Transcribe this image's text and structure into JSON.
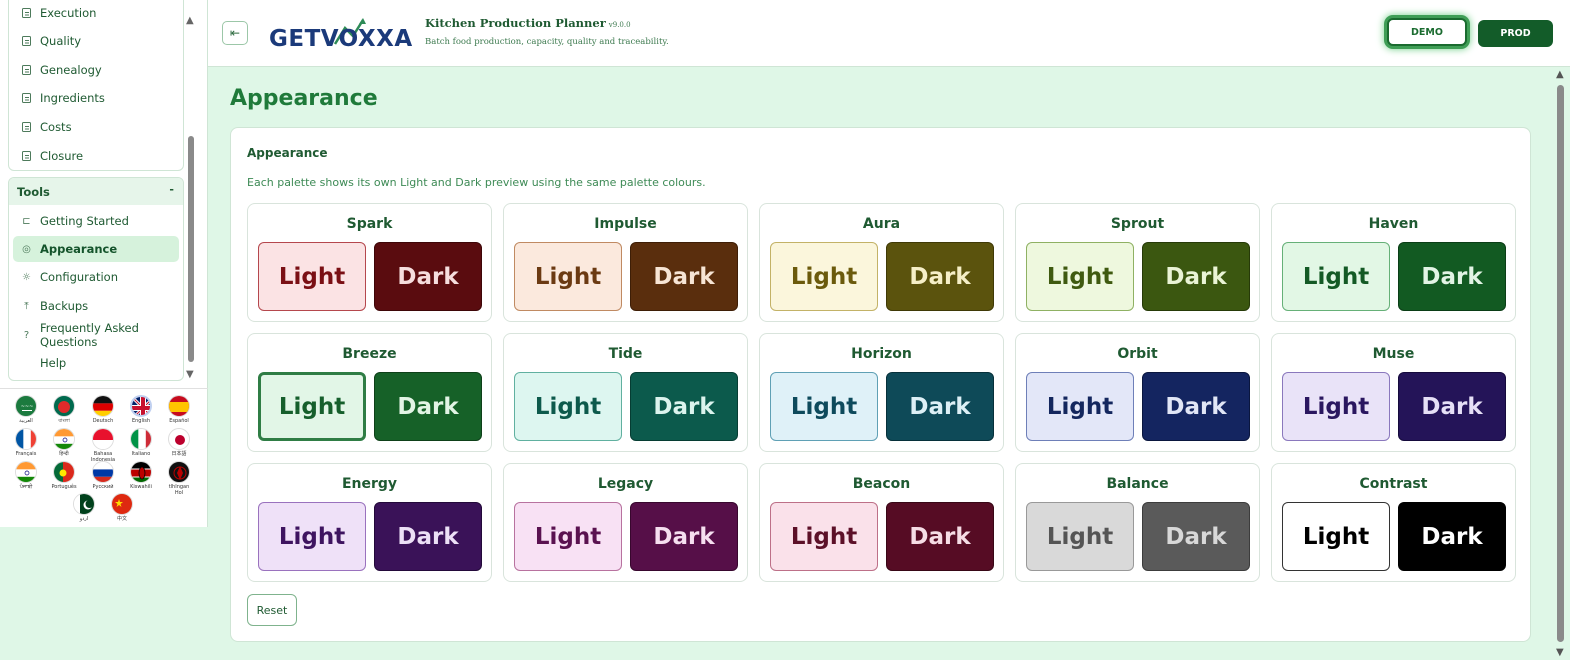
{
  "sidebar": {
    "top_items": [
      {
        "label": "Execution",
        "icon": "document-icon"
      },
      {
        "label": "Quality",
        "icon": "document-icon"
      },
      {
        "label": "Genealogy",
        "icon": "document-icon"
      },
      {
        "label": "Ingredients",
        "icon": "document-icon"
      },
      {
        "label": "Costs",
        "icon": "document-icon"
      },
      {
        "label": "Closure",
        "icon": "document-icon"
      }
    ],
    "tools": {
      "header": "Tools",
      "collapse_symbol": "-",
      "items": [
        {
          "label": "Getting Started",
          "icon": "flag-icon",
          "glyph": "⊏"
        },
        {
          "label": "Appearance",
          "icon": "palette-icon",
          "glyph": "◎",
          "active": true
        },
        {
          "label": "Configuration",
          "icon": "sun-icon",
          "glyph": "☼"
        },
        {
          "label": "Backups",
          "icon": "upload-icon",
          "glyph": "⤒"
        },
        {
          "label": "Frequently Asked Questions",
          "icon": "help-circle-icon",
          "glyph": "?"
        },
        {
          "label": "Help",
          "icon": "",
          "glyph": ""
        }
      ]
    },
    "languages": [
      {
        "label": "العربية",
        "code": "ar"
      },
      {
        "label": "বাংলা",
        "code": "bn"
      },
      {
        "label": "Deutsch",
        "code": "de"
      },
      {
        "label": "English",
        "code": "en"
      },
      {
        "label": "Español",
        "code": "es"
      },
      {
        "label": "Français",
        "code": "fr"
      },
      {
        "label": "हिन्दी",
        "code": "hi"
      },
      {
        "label": "Bahasa Indonesia",
        "code": "id"
      },
      {
        "label": "Italiano",
        "code": "it"
      },
      {
        "label": "日本語",
        "code": "ja"
      },
      {
        "label": "ਪੰਜਾਬੀ",
        "code": "pa"
      },
      {
        "label": "Português",
        "code": "pt"
      },
      {
        "label": "Русский",
        "code": "ru"
      },
      {
        "label": "Kiswahili",
        "code": "sw"
      },
      {
        "label": "tlhIngan Hol",
        "code": "tlh"
      },
      {
        "label": "اردو",
        "code": "ur"
      },
      {
        "label": "中文",
        "code": "zh"
      }
    ]
  },
  "header": {
    "logo_text": "GETVOXXA",
    "app_title": "Kitchen Production Planner",
    "version": "v9.0.0",
    "subtitle": "Batch food production, capacity, quality and traceability.",
    "demo_label": "DEMO",
    "prod_label": "PROD"
  },
  "page": {
    "title": "Appearance",
    "card_title": "Appearance",
    "description": "Each palette shows its own Light and Dark preview using the same palette colours.",
    "reset_label": "Reset",
    "palettes": [
      {
        "name": "Spark",
        "light": "Light",
        "dark": "Dark",
        "light_bg": "#fbe3e4",
        "light_fg": "#7a0f14",
        "light_border": "#b5474d",
        "dark_bg": "#5a0c0f",
        "dark_fg": "#f6dede",
        "dark_border": "#3e0608"
      },
      {
        "name": "Impulse",
        "light": "Light",
        "dark": "Dark",
        "light_bg": "#fbe9dd",
        "light_fg": "#6b3a12",
        "light_border": "#c08a62",
        "dark_bg": "#5a2e0d",
        "dark_fg": "#f7e5d5",
        "dark_border": "#3e1e06"
      },
      {
        "name": "Aura",
        "light": "Light",
        "dark": "Dark",
        "light_bg": "#fbf6dc",
        "light_fg": "#6b5a0c",
        "light_border": "#c3b267",
        "dark_bg": "#5b530d",
        "dark_fg": "#f6efc7",
        "dark_border": "#3f3906"
      },
      {
        "name": "Sprout",
        "light": "Light",
        "dark": "Dark",
        "light_bg": "#eef8de",
        "light_fg": "#3f5a10",
        "light_border": "#8fb163",
        "dark_bg": "#3b5710",
        "dark_fg": "#eaf4d6",
        "dark_border": "#263a08"
      },
      {
        "name": "Haven",
        "light": "Light",
        "dark": "Dark",
        "light_bg": "#e2f7e5",
        "light_fg": "#145a25",
        "light_border": "#66b078",
        "dark_bg": "#125a22",
        "dark_fg": "#e2f4e5",
        "dark_border": "#0a3d16"
      },
      {
        "name": "Breeze",
        "light": "Light",
        "dark": "Dark",
        "light_bg": "#e2f6e7",
        "light_fg": "#165f2c",
        "light_border": "#2f7d45",
        "dark_bg": "#166128",
        "dark_fg": "#e2f4e5",
        "dark_border": "#0e4019",
        "selected": true
      },
      {
        "name": "Tide",
        "light": "Light",
        "dark": "Dark",
        "light_bg": "#ddf6f0",
        "light_fg": "#0d5a4c",
        "light_border": "#60b0a0",
        "dark_bg": "#0c5a4c",
        "dark_fg": "#dcf4ee",
        "dark_border": "#063d33"
      },
      {
        "name": "Horizon",
        "light": "Light",
        "dark": "Dark",
        "light_bg": "#dff1f8",
        "light_fg": "#0e4a5c",
        "light_border": "#5fa0b5",
        "dark_bg": "#0e4a58",
        "dark_fg": "#ddf0f6",
        "dark_border": "#06303a"
      },
      {
        "name": "Orbit",
        "light": "Light",
        "dark": "Dark",
        "light_bg": "#e3e7f8",
        "light_fg": "#14275e",
        "light_border": "#6e7fb8",
        "dark_bg": "#142560",
        "dark_fg": "#e1e6f6",
        "dark_border": "#0a163e"
      },
      {
        "name": "Muse",
        "light": "Light",
        "dark": "Dark",
        "light_bg": "#e9e3f8",
        "light_fg": "#2a1760",
        "light_border": "#8a78bd",
        "dark_bg": "#241458",
        "dark_fg": "#e6e0f6",
        "dark_border": "#150a3c"
      },
      {
        "name": "Energy",
        "light": "Light",
        "dark": "Dark",
        "light_bg": "#efe1f8",
        "light_fg": "#3e1460",
        "light_border": "#9a72be",
        "dark_bg": "#3a1258",
        "dark_fg": "#ece0f6",
        "dark_border": "#23093a"
      },
      {
        "name": "Legacy",
        "light": "Light",
        "dark": "Dark",
        "light_bg": "#f8e1f4",
        "light_fg": "#5a1250",
        "light_border": "#b8729f",
        "dark_bg": "#560f48",
        "dark_fg": "#f6dff0",
        "dark_border": "#38072e"
      },
      {
        "name": "Beacon",
        "light": "Light",
        "dark": "Dark",
        "light_bg": "#fae1ea",
        "light_fg": "#5c1028",
        "light_border": "#bd7088",
        "dark_bg": "#560c24",
        "dark_fg": "#f6dde5",
        "dark_border": "#380716"
      },
      {
        "name": "Balance",
        "light": "Light",
        "dark": "Dark",
        "light_bg": "#d9d9d9",
        "light_fg": "#555555",
        "light_border": "#999999",
        "dark_bg": "#5a5a5a",
        "dark_fg": "#d8d8d8",
        "dark_border": "#3c3c3c"
      },
      {
        "name": "Contrast",
        "light": "Light",
        "dark": "Dark",
        "light_bg": "#ffffff",
        "light_fg": "#000000",
        "light_border": "#333333",
        "dark_bg": "#000000",
        "dark_fg": "#ffffff",
        "dark_border": "#000000"
      }
    ]
  }
}
